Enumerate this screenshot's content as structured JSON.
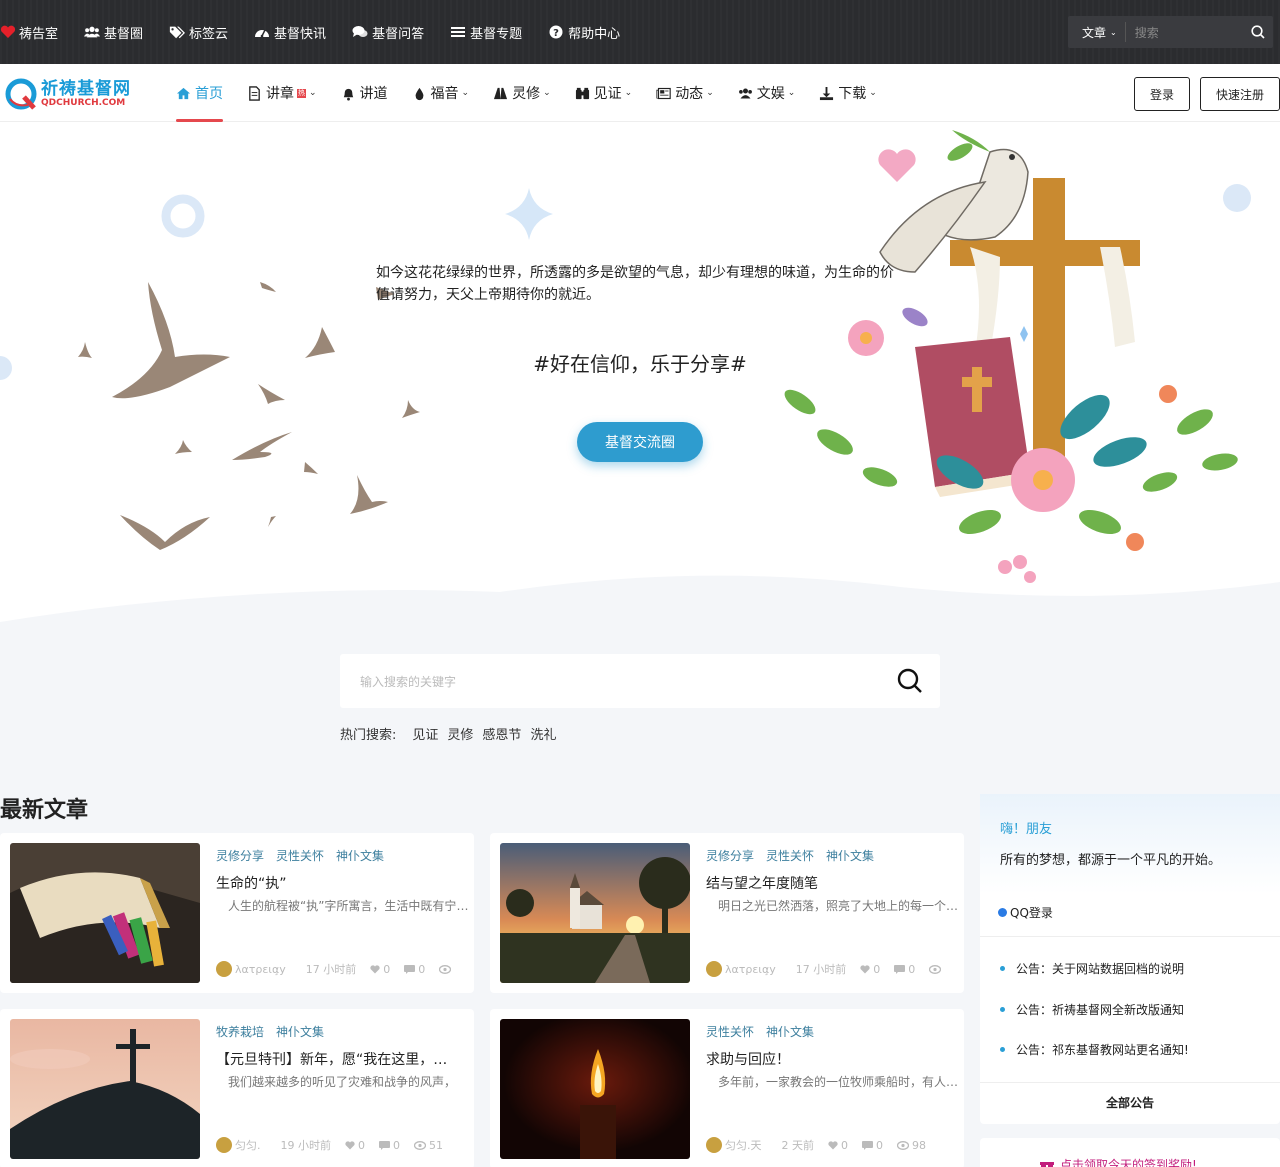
{
  "topbar": {
    "items": [
      {
        "label": "祷告室",
        "icon": "heart-icon"
      },
      {
        "label": "基督圈",
        "icon": "users-icon"
      },
      {
        "label": "标签云",
        "icon": "tags-icon"
      },
      {
        "label": "基督快讯",
        "icon": "dashboard-icon"
      },
      {
        "label": "基督问答",
        "icon": "comments-icon"
      },
      {
        "label": "基督专题",
        "icon": "list-icon"
      },
      {
        "label": "帮助中心",
        "icon": "question-circle-icon"
      }
    ],
    "search_select": "文章",
    "search_placeholder": "搜索"
  },
  "header": {
    "logo_cn": "祈祷基督网",
    "logo_en": "QDCHURCH.COM",
    "nav": [
      {
        "label": "首页",
        "icon": "home-icon",
        "active": true,
        "caret": false
      },
      {
        "label": "讲章",
        "icon": "document-icon",
        "hot": "热",
        "caret": true
      },
      {
        "label": "讲道",
        "icon": "bell-icon",
        "caret": false
      },
      {
        "label": "福音",
        "icon": "drop-icon",
        "caret": true
      },
      {
        "label": "灵修",
        "icon": "road-icon",
        "caret": true
      },
      {
        "label": "见证",
        "icon": "binoculars-icon",
        "caret": true
      },
      {
        "label": "动态",
        "icon": "newspaper-icon",
        "caret": true
      },
      {
        "label": "文娱",
        "icon": "users-icon",
        "caret": true
      },
      {
        "label": "下载",
        "icon": "download-icon",
        "caret": true
      }
    ],
    "login": "登录",
    "register": "快速注册"
  },
  "hero": {
    "text": "如今这花花绿绿的世界，所透露的多是欲望的气息，却少有理想的味道，为生命的价值请努力，天父上帝期待你的就近。",
    "slogan": "#好在信仰，乐于分享#",
    "button": "基督交流圈"
  },
  "search": {
    "placeholder": "输入搜索的关键字",
    "hot_label": "热门搜索:",
    "hot_keywords": [
      "见证",
      "灵修",
      "感恩节",
      "洗礼"
    ]
  },
  "latest": {
    "title": "最新文章",
    "posts": [
      {
        "tags": [
          "灵修分享",
          "灵性关怀",
          "神仆文集"
        ],
        "title": "生命的“执”",
        "excerpt": "人生的航程被“执”字所寓言，生活中既有宁静与安详，亦有风浪与波澜。",
        "author": "λατρεια̧y",
        "time": "17 小时前",
        "likes": "0",
        "comments": "0",
        "views": "",
        "thumb": "bible"
      },
      {
        "tags": [
          "灵修分享",
          "灵性关怀",
          "神仆文集"
        ],
        "title": "结与望之年度随笔",
        "excerpt": "明日之光已然洒落，照亮了大地上的每一个角落。",
        "author": "λατρεια̧y",
        "time": "17 小时前",
        "likes": "0",
        "comments": "0",
        "views": "",
        "thumb": "church"
      },
      {
        "tags": [
          "牧养栽培",
          "神仆文集"
        ],
        "title": "【元旦特刊】新年，愿“我在这里，请差遣我”",
        "excerpt": "我们越来越多的听见了灾难和战争的风声，",
        "author": "匀匀.",
        "time": "19 小时前",
        "likes": "0",
        "comments": "0",
        "views": "51",
        "thumb": "cross"
      },
      {
        "tags": [
          "灵性关怀",
          "神仆文集"
        ],
        "title": "求助与回应！",
        "excerpt": "多年前，一家教会的一位牧师乘船时，有人问他",
        "author": "匀匀.天",
        "time": "2 天前",
        "likes": "0",
        "comments": "0",
        "views": "98",
        "thumb": "candle"
      }
    ]
  },
  "sidebar": {
    "greeting": "嗨！朋友",
    "greeting_sub": "所有的梦想，都源于一个平凡的开始。",
    "qq_login": "QQ登录",
    "notices": [
      "公告：关于网站数据回档的说明",
      "公告：祈祷基督网全新改版通知",
      "公告：祁东基督教网站更名通知!"
    ],
    "all_notices": "全部公告",
    "checkin": "点击领取今天的签到奖励!"
  },
  "colors": {
    "accent": "#2a9fd6",
    "active_underline": "#e5484d",
    "topbar_bg": "#2b2c2f",
    "hero_button": "#2e9ccf"
  }
}
